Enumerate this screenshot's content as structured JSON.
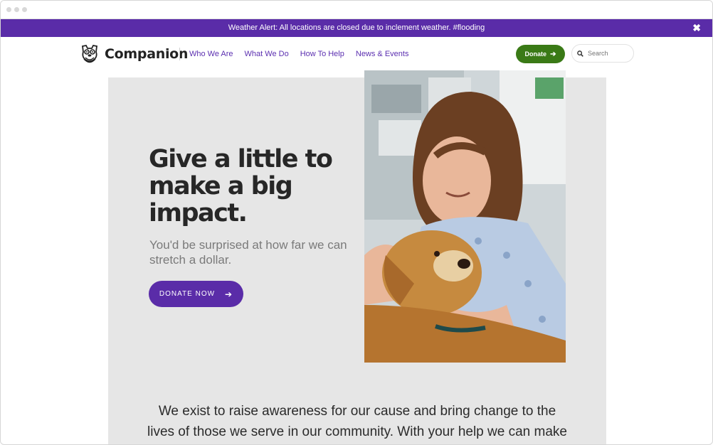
{
  "alert": {
    "text": "Weather Alert: All locations are closed due to inclement weather. #flooding",
    "close": "✖"
  },
  "brand": {
    "name": "Companion",
    "logo_icon": "dog-logo-icon"
  },
  "nav": {
    "links": [
      "Who We Are",
      "What We Do",
      "How To Help",
      "News & Events"
    ],
    "donate": "Donate",
    "search_placeholder": "Search"
  },
  "hero": {
    "title": "Give a little to make a big impact.",
    "subtitle": "You'd be surprised at how far we can stretch a dollar.",
    "cta": "DONATE NOW"
  },
  "mission": {
    "text": "We exist to raise awareness for our cause and bring change to the lives of those we serve in our community. With your help we can make a"
  },
  "colors": {
    "brand_purple": "#5a2ca8",
    "donate_green": "#3a7a16",
    "hero_bg": "#e6e6e6"
  }
}
